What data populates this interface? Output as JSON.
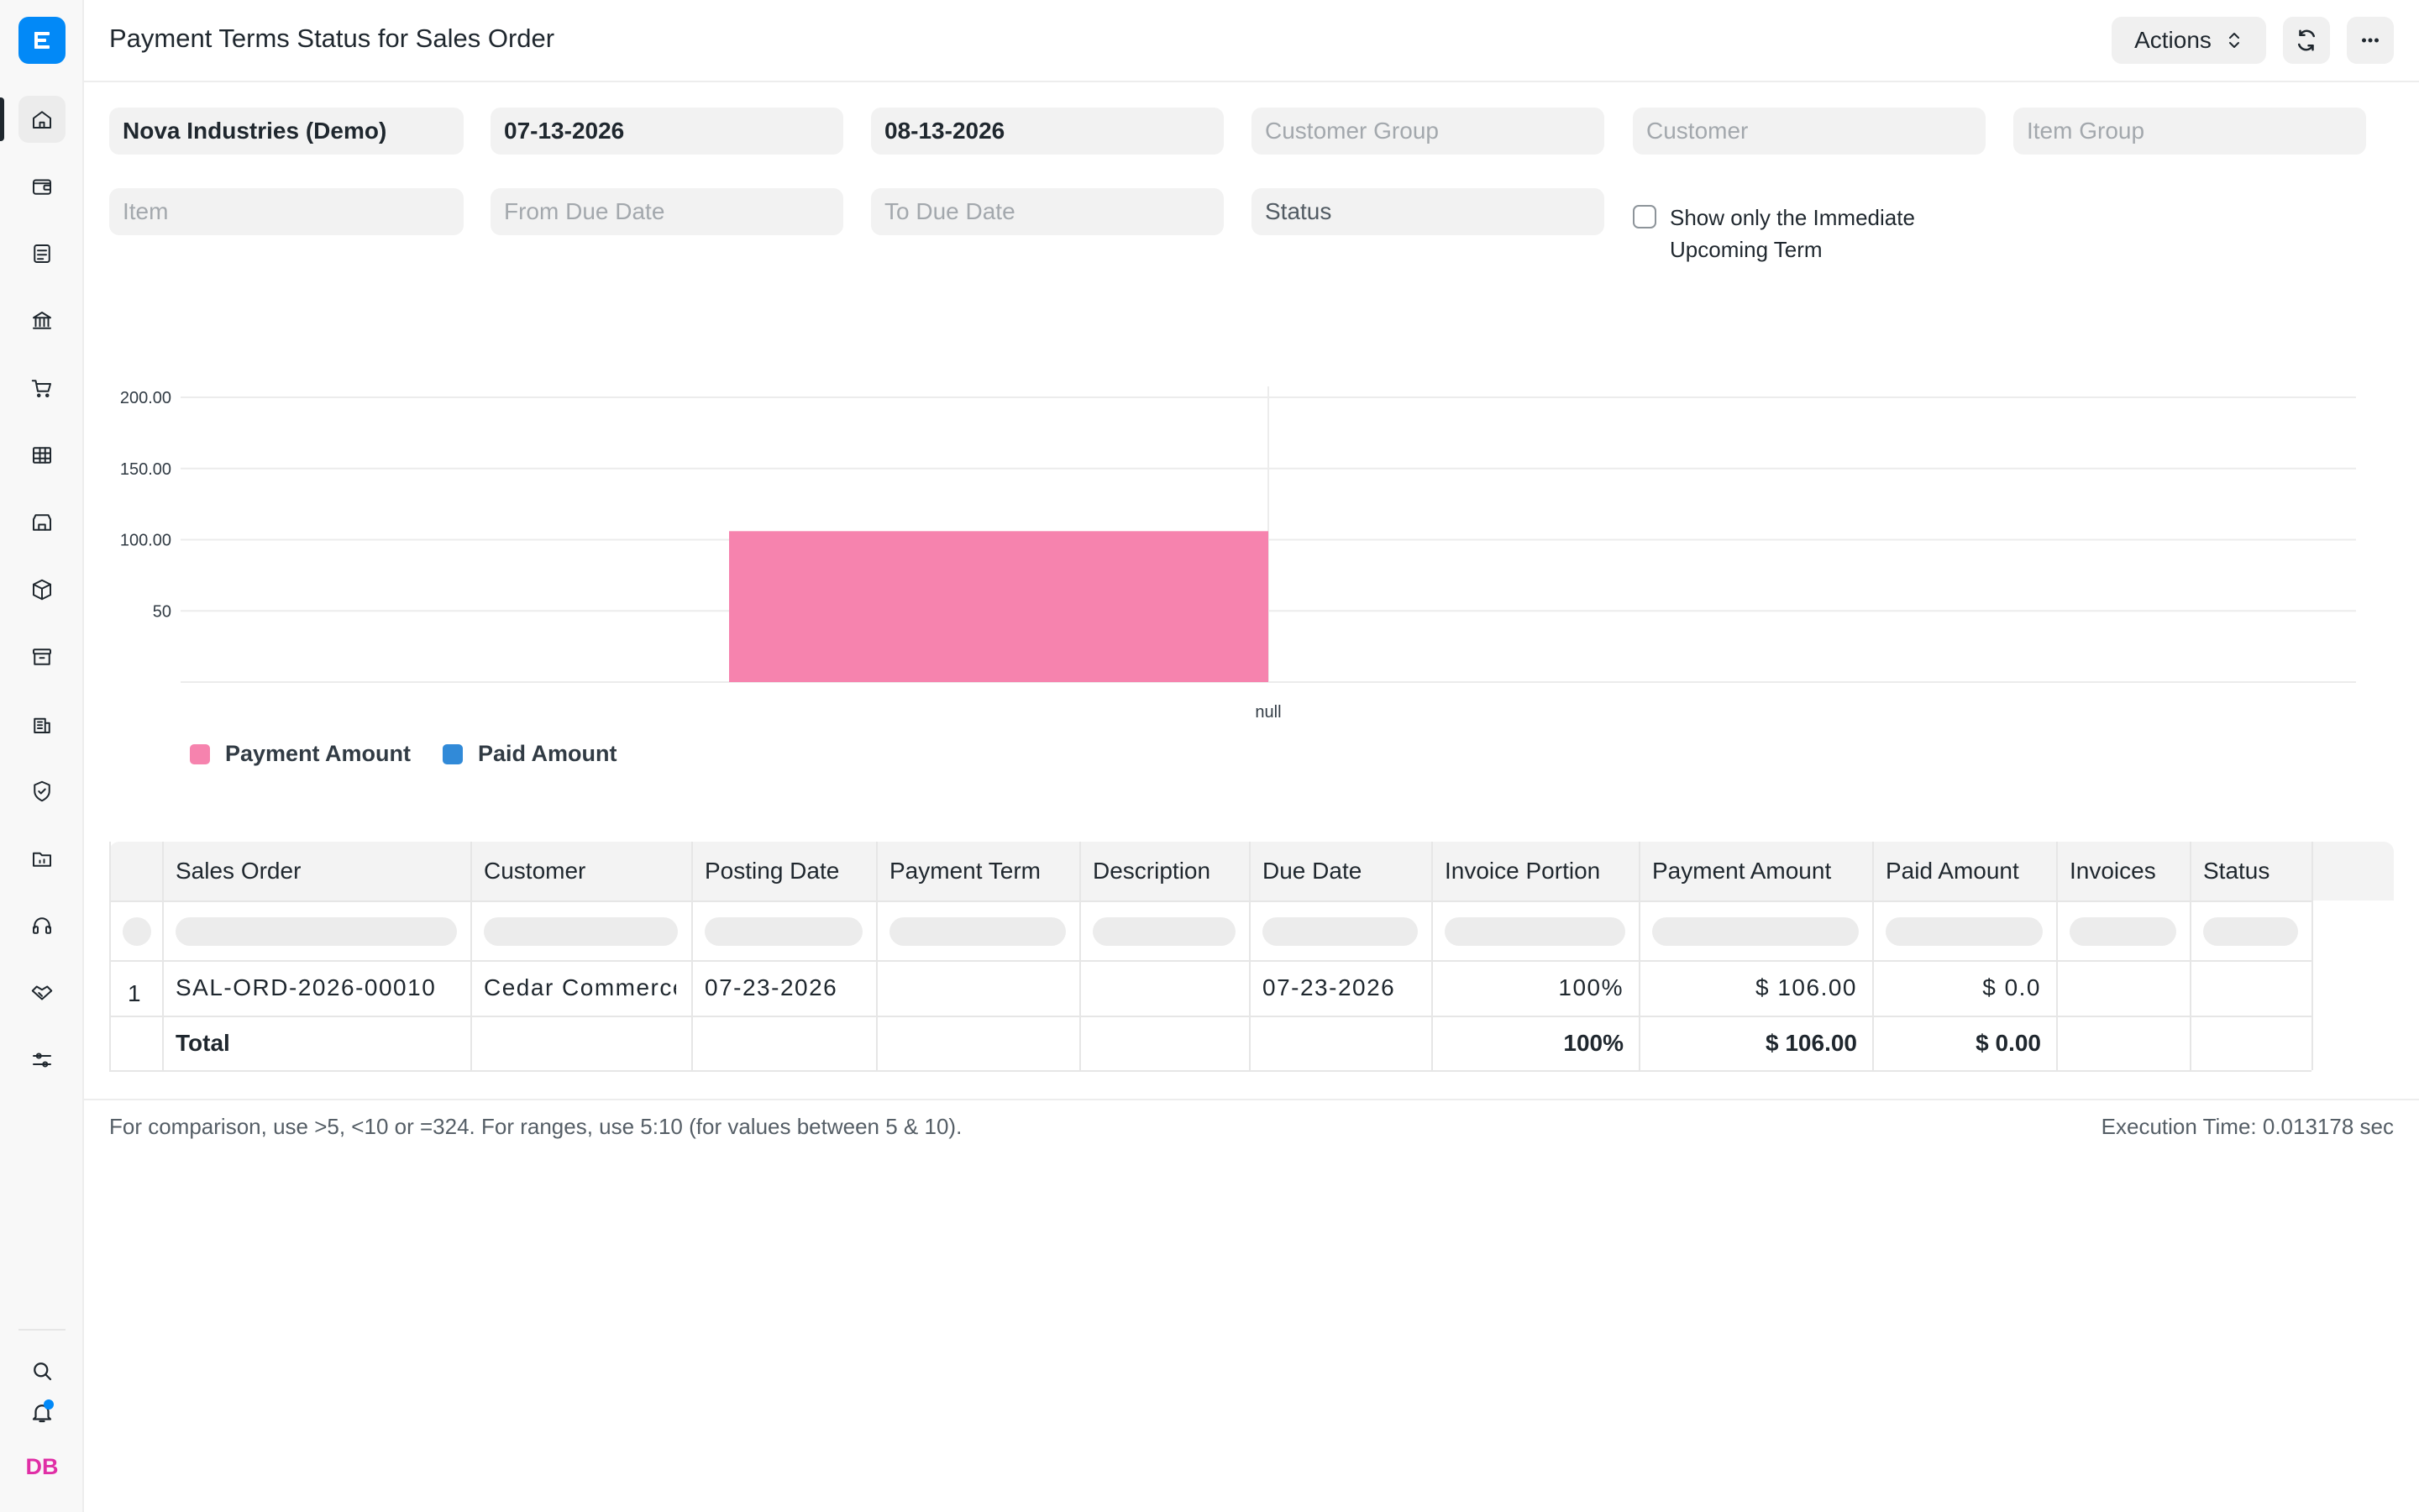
{
  "header": {
    "title": "Payment Terms Status for Sales Order",
    "actions_label": "Actions"
  },
  "filters": {
    "company": "Nova Industries (Demo)",
    "from_date": "07-13-2026",
    "to_date": "08-13-2026",
    "customer_group_placeholder": "Customer Group",
    "customer_placeholder": "Customer",
    "item_group_placeholder": "Item Group",
    "item_placeholder": "Item",
    "from_due_date_placeholder": "From Due Date",
    "to_due_date_placeholder": "To Due Date",
    "status_placeholder": "Status",
    "immediate_term_label_line1": "Show only the Immediate",
    "immediate_term_label_line2": "Upcoming Term",
    "immediate_term_checked": false
  },
  "chart_data": {
    "type": "bar",
    "categories": [
      "null"
    ],
    "series": [
      {
        "name": "Payment Amount",
        "values": [
          106.0
        ],
        "color": "#f683ae"
      },
      {
        "name": "Paid Amount",
        "values": [
          0.0
        ],
        "color": "#318ad8"
      }
    ],
    "yticks": [
      "50",
      "100.00",
      "150.00",
      "200.00"
    ],
    "ylim": [
      0,
      200
    ],
    "grid": true,
    "legend_position": "bottom-left"
  },
  "table": {
    "columns": [
      "Sales Order",
      "Customer",
      "Posting Date",
      "Payment Term",
      "Description",
      "Due Date",
      "Invoice Portion",
      "Payment Amount",
      "Paid Amount",
      "Invoices",
      "Status"
    ],
    "rows": [
      {
        "index": "1",
        "sales_order": "SAL-ORD-2026-00010",
        "customer": "Cedar Commerce",
        "posting_date": "07-23-2026",
        "payment_term": "",
        "description": "",
        "due_date": "07-23-2026",
        "invoice_portion": "100%",
        "payment_amount": "$ 106.00",
        "paid_amount": "$ 0.0",
        "invoices": "",
        "status": ""
      }
    ],
    "total": {
      "label": "Total",
      "invoice_portion": "100%",
      "payment_amount": "$ 106.00",
      "paid_amount": "$ 0.00"
    }
  },
  "footer": {
    "note": "For comparison, use >5, <10 or =324. For ranges, use 5:10 (for values between 5 & 10).",
    "execution_time": "Execution Time: 0.013178 sec"
  },
  "user": {
    "initials": "DB"
  },
  "sidebar": {
    "icons": [
      "home-icon",
      "wallet-icon",
      "document-icon",
      "bank-icon",
      "cart-icon",
      "table-icon",
      "store-icon",
      "package-icon",
      "archive-icon",
      "building-icon",
      "shield-icon",
      "folder-icon",
      "headset-icon",
      "handshake-icon",
      "sliders-icon"
    ]
  }
}
